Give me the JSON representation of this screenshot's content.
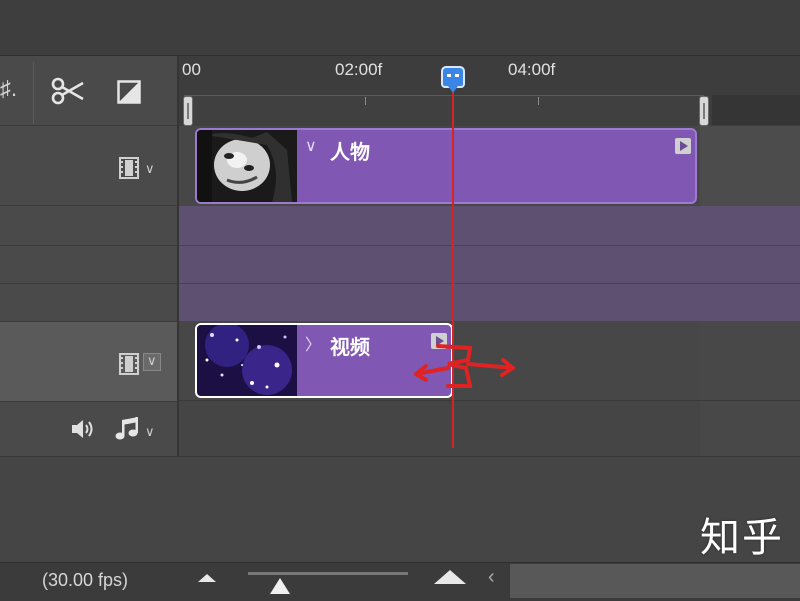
{
  "toolbar": {
    "cut_icon": "scissors-icon",
    "transition_icon": "transition-icon",
    "left_fragment": "♯."
  },
  "ruler": {
    "labels": [
      "00",
      "02:00f",
      "04:00f"
    ]
  },
  "tracks": {
    "video1": {
      "clip_label": "人物",
      "track_icon": "film-icon"
    },
    "video2": {
      "clip_label": "视频",
      "track_icon": "film-icon"
    },
    "audio": {
      "volume_icon": "speaker-icon",
      "music_icon": "music-note-icon"
    }
  },
  "status": {
    "fps": "(30.00 fps)"
  },
  "watermark": "知乎",
  "colors": {
    "clip": "#8057b3",
    "playhead": "#d42424",
    "playhead_head": "#3a86e6"
  }
}
